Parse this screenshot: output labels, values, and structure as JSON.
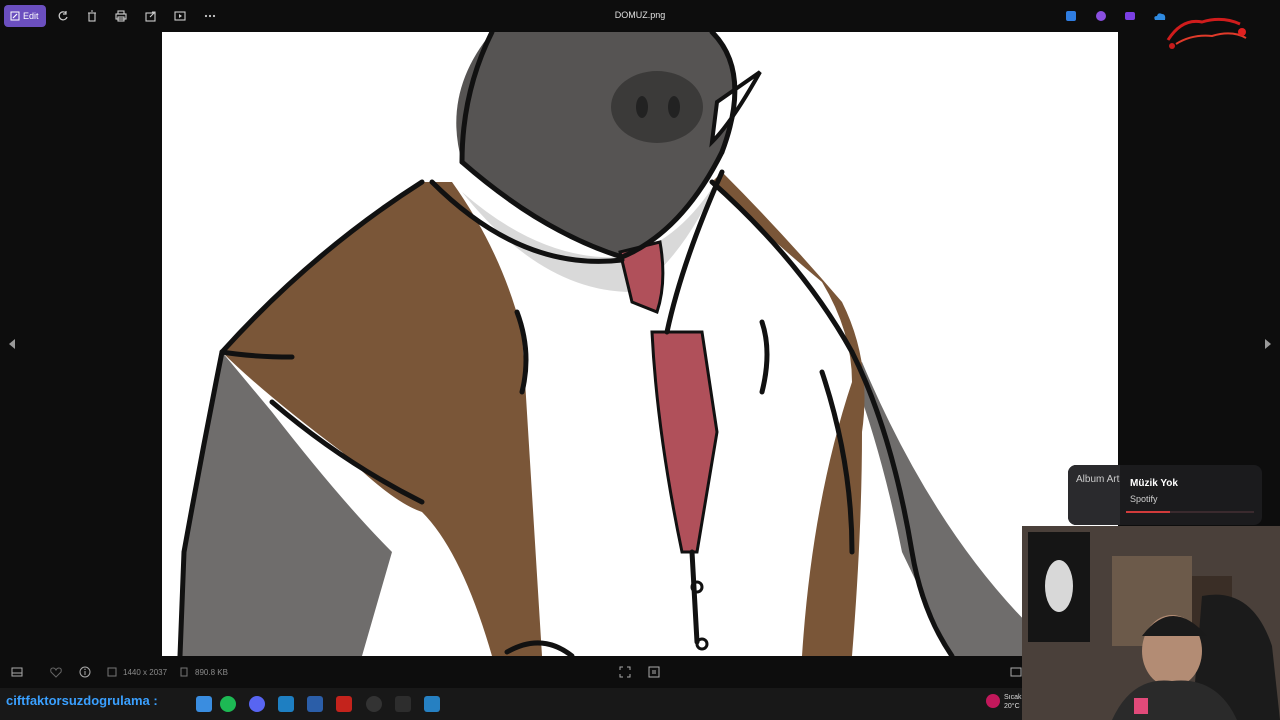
{
  "toolbar": {
    "edit_label": "Edit",
    "file_name": "DOMUZ.png",
    "actions": [
      "rotate-icon",
      "delete-icon",
      "print-icon",
      "share-icon",
      "slideshow-icon",
      "more-icon"
    ]
  },
  "image_info": {
    "dimensions": "1440 x 2037",
    "file_size": "890.8 KB"
  },
  "spotify": {
    "album_art_alt": "Album Art",
    "title": "Müzik Yok",
    "source": "Spotify",
    "progress": 0.34
  },
  "taskbar": {
    "marquee": "ciftfaktorsuzdogrulama :",
    "weather_line1": "Sıcak",
    "weather_line2": "20°C"
  },
  "colors": {
    "accent": "#6b4fbf",
    "taskbar_text": "#3aa0ff",
    "spotify_progress": "#d13b3b",
    "vest": "#7a5638",
    "tie": "#b0505a",
    "skin": "#6f6d6c"
  }
}
